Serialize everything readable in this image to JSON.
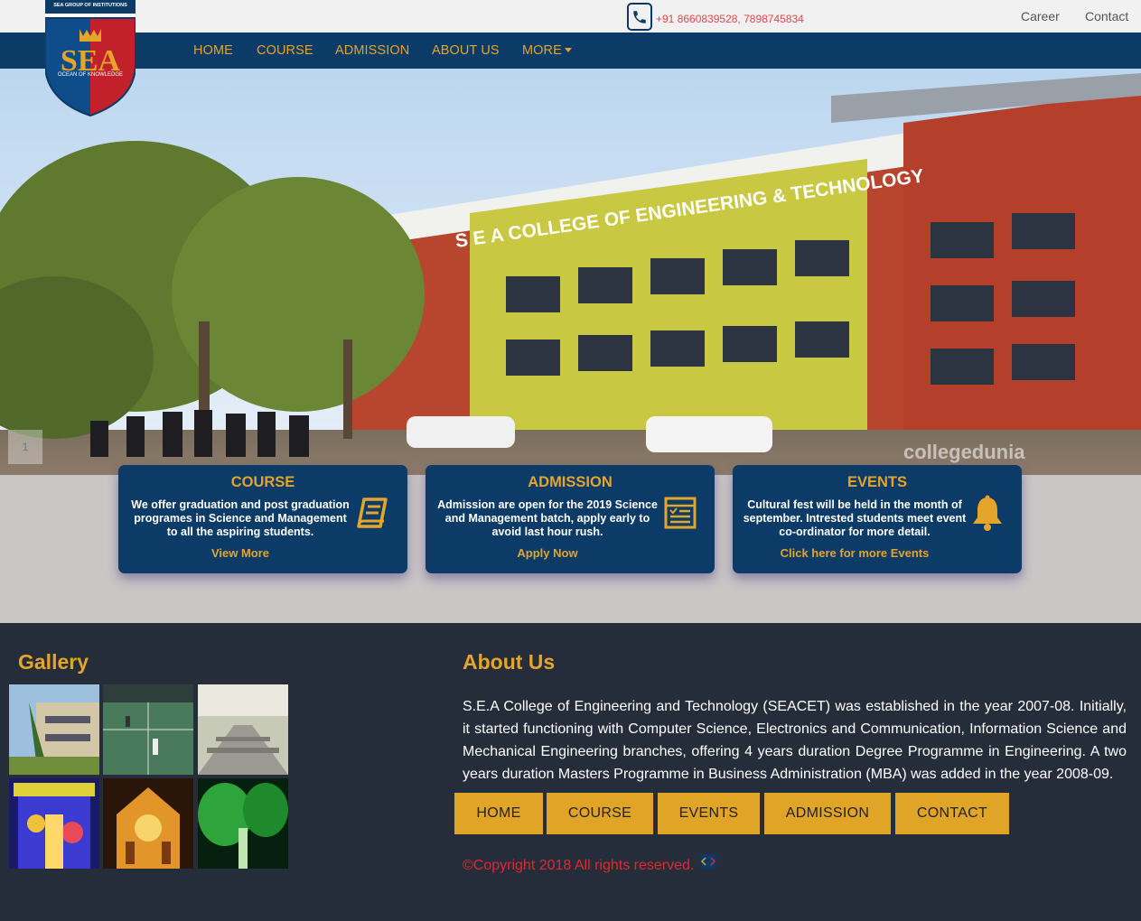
{
  "topbar": {
    "phone": "+91 8660839528, 7898745834",
    "career": "Career",
    "contact": "Contact"
  },
  "logo": {
    "group_text": "SEA GROUP OF INSTITUTIONS",
    "mark": "SEA",
    "tagline": "OCEAN OF KNOWLEDGE"
  },
  "nav": {
    "home": "HOME",
    "course": "COURSE",
    "admission": "ADMISSION",
    "about": "ABOUT US",
    "more": "MORE"
  },
  "hero": {
    "sign": "S E A COLLEGE OF ENGINEERING & TECHNOLOGY",
    "watermark": "collegedunia",
    "slide_number": "1"
  },
  "cards": [
    {
      "title": "COURSE",
      "text": "We offer graduation and post graduation programes in Science and Management to all the aspiring students.",
      "link": "View More",
      "icon": "book-icon"
    },
    {
      "title": "ADMISSION",
      "text": "Admission are open for the 2019 Science and Management batch, apply early to avoid last hour rush.",
      "link": "Apply Now",
      "icon": "form-icon"
    },
    {
      "title": "EVENTS",
      "text": "Cultural fest will be held in the month of september. Intrested students meet event co-ordinator for more detail.",
      "link": "Click here for more Events",
      "icon": "bell-icon"
    }
  ],
  "footer": {
    "gallery_title": "Gallery",
    "about_title": "About Us",
    "about_text": "S.E.A College of Engineering and Technology (SEACET) was established in the year 2007-08. Initially, it started functioning with Computer Science, Electronics and Communication, Information Science and Mechanical Engineering branches, offering 4 years duration Degree Programme in Engineering. A two years duration Masters Programme in Business Administration (MBA) was added in the year 2008-09.",
    "buttons": {
      "home": "HOME",
      "course": "COURSE",
      "events": "EVENTS",
      "admission": "ADMISSION",
      "contact": "CONTACT"
    },
    "copyright": "©Copyright 2018 All rights reserved."
  },
  "colors": {
    "navy": "#0b3b66",
    "gold": "#e4a52a",
    "footer_bg": "#262d3a",
    "copyright_red": "#e2282e"
  }
}
